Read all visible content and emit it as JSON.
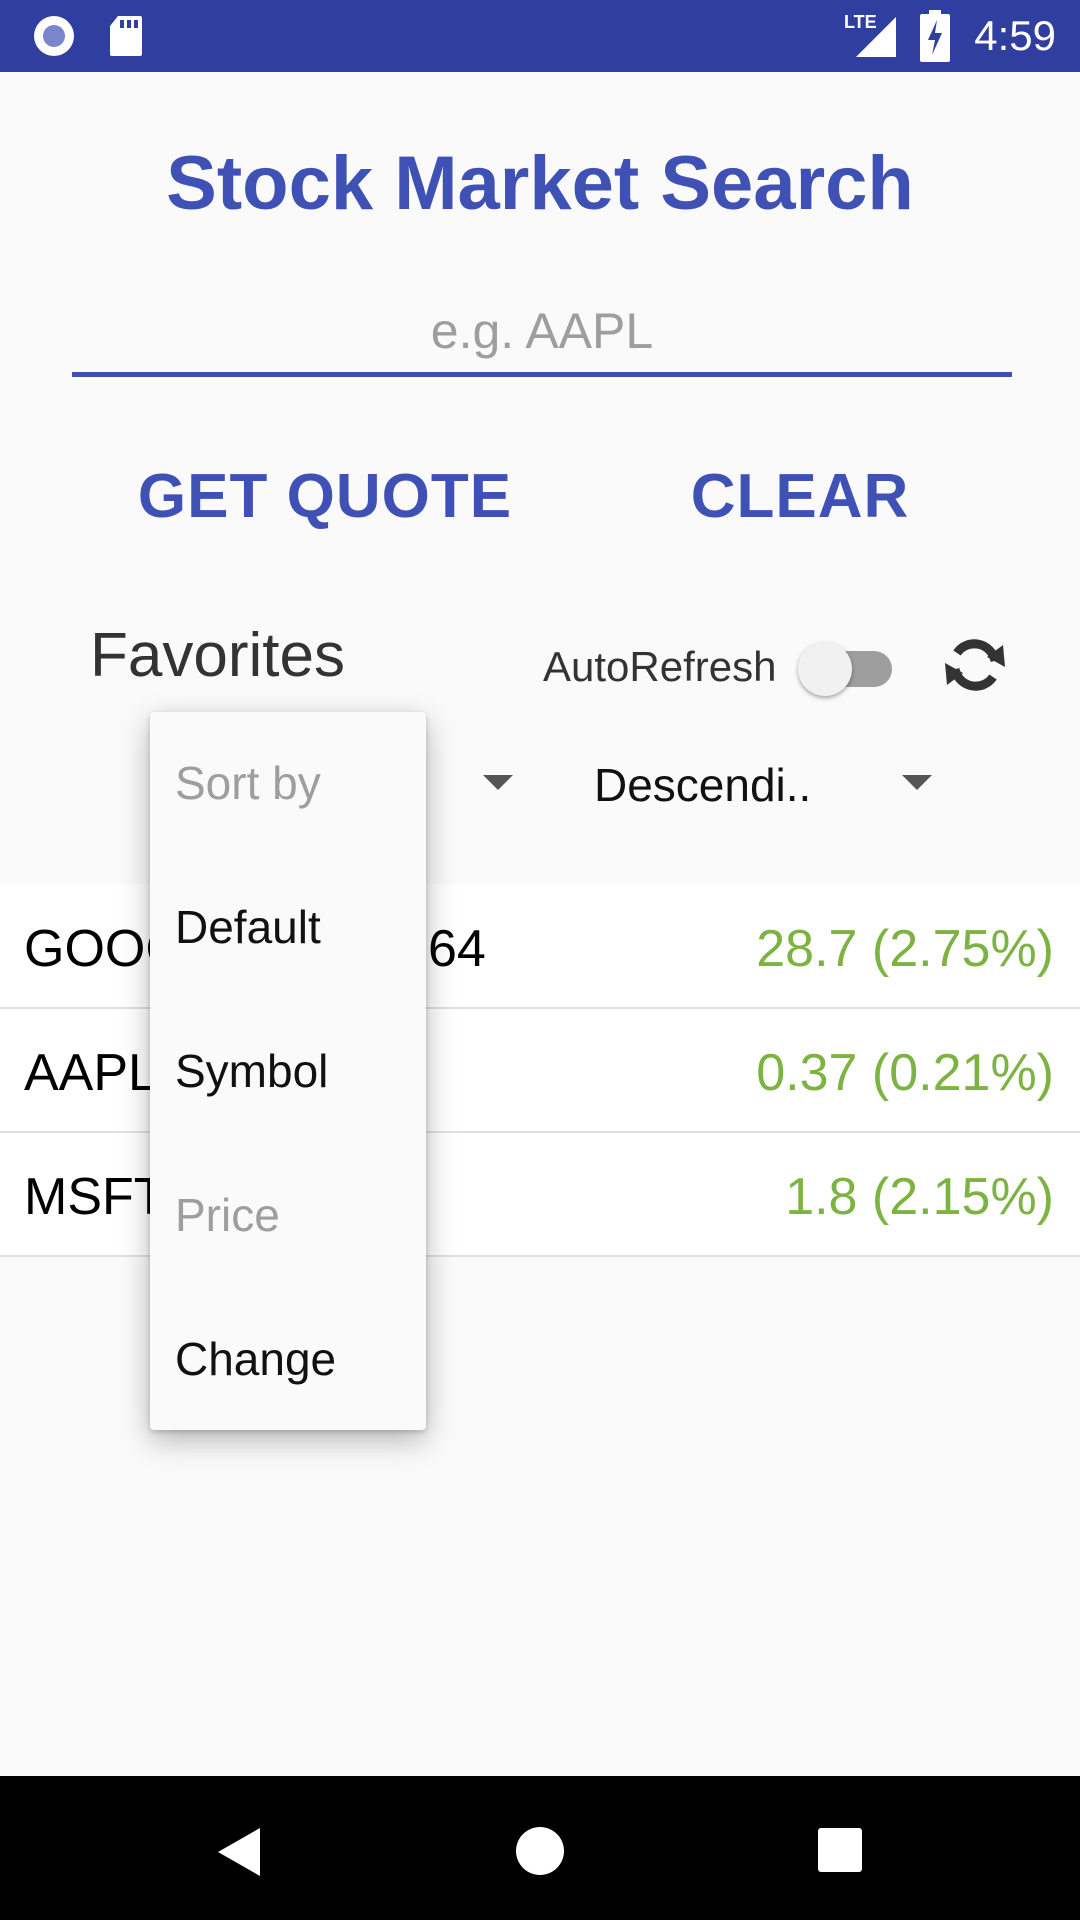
{
  "status_bar": {
    "time": "4:59",
    "network": "LTE",
    "icons": [
      "notification-circle-icon",
      "sd-card-icon",
      "lte-signal-icon",
      "battery-charging-icon"
    ]
  },
  "app": {
    "title": "Stock Market Search"
  },
  "search": {
    "placeholder": "e.g. AAPL",
    "value": ""
  },
  "buttons": {
    "get_quote": "GET QUOTE",
    "clear": "CLEAR"
  },
  "favorites": {
    "label": "Favorites",
    "autorefresh_label": "AutoRefresh",
    "autorefresh_on": false,
    "sort_order_selected": "Descendi..",
    "sort_menu": {
      "header": "Sort by",
      "items": [
        {
          "label": "Default",
          "enabled": true
        },
        {
          "label": "Symbol",
          "enabled": true
        },
        {
          "label": "Price",
          "enabled": false
        },
        {
          "label": "Change",
          "enabled": true
        }
      ]
    },
    "stocks": [
      {
        "symbol": "GOOG",
        "price_visible": "64",
        "change": "28.7 (2.75%)"
      },
      {
        "symbol": "AAPL",
        "price_visible": "",
        "change": "0.37 (0.21%)"
      },
      {
        "symbol": "MSFT",
        "price_visible": "",
        "change": "1.8 (2.15%)"
      }
    ]
  },
  "colors": {
    "primary": "#3f51b5",
    "status_bar": "#303f9f",
    "positive_change": "#7cb342"
  }
}
